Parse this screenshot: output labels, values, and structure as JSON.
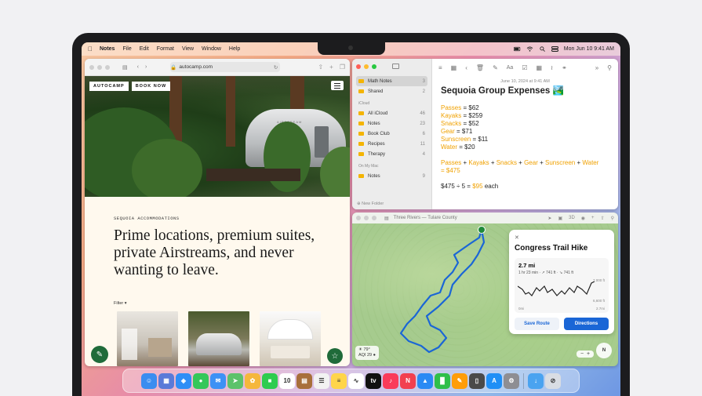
{
  "menubar": {
    "app": "Notes",
    "items": [
      "File",
      "Edit",
      "Format",
      "View",
      "Window",
      "Help"
    ],
    "clock": "Mon Jun 10  9:41 AM"
  },
  "safari": {
    "url": "autocamp.com",
    "brand_name": "AUTOCAMP",
    "brand_cta": "BOOK NOW",
    "eyebrow": "SEQUOIA ACCOMMODATIONS",
    "headline": "Prime locations, premium suites, private Airstreams, and never wanting to leave.",
    "filter": "Filter ▾",
    "airstream_text": "AIRSTREAM"
  },
  "notes": {
    "folders_top": [
      {
        "name": "Math Notes",
        "count": "3"
      },
      {
        "name": "Shared",
        "count": "2"
      }
    ],
    "section_icloud": "iCloud",
    "folders_icloud": [
      {
        "name": "All iCloud",
        "count": "46"
      },
      {
        "name": "Notes",
        "count": "23"
      },
      {
        "name": "Book Club",
        "count": "6"
      },
      {
        "name": "Recipes",
        "count": "11"
      },
      {
        "name": "Therapy",
        "count": "4"
      }
    ],
    "section_mac": "On My Mac",
    "folders_mac": [
      {
        "name": "Notes",
        "count": "9"
      }
    ],
    "new_folder": "New Folder",
    "date": "June 10, 2024 at 9:41 AM",
    "title": "Sequoia Group Expenses 🏞️",
    "lines": [
      {
        "label": "Passes",
        "value": "= $62"
      },
      {
        "label": "Kayaks",
        "value": "= $259"
      },
      {
        "label": "Snacks",
        "value": "= $52"
      },
      {
        "label": "Gear",
        "value": "= $71"
      },
      {
        "label": "Sunscreen",
        "value": "= $11"
      },
      {
        "label": "Water",
        "value": "= $20"
      }
    ],
    "sum_terms": [
      "Passes",
      "Kayaks",
      "Snacks",
      "Gear",
      "Sunscreen",
      "Water"
    ],
    "sum_result": "= $475",
    "split_expr": "$475 ÷ 5 =",
    "split_result": "$95",
    "split_suffix": "each"
  },
  "maps": {
    "location": "Three Rivers — Tulare County",
    "card_title": "Congress Trail Hike",
    "distance": "2.7 mi",
    "meta": "1 hr 23 min  ·  ↗ 741 ft  ·  ↘ 741 ft",
    "elev_max": "7,000 ft",
    "elev_min": "6,600 ft",
    "x_start": "0mi",
    "x_end": "2.7mi",
    "save_route": "Save Route",
    "directions": "Directions",
    "weather_temp": "☀ 79°",
    "weather_aqi": "AQI 29 ●",
    "compass": "N",
    "toolbar_3d": "3D"
  },
  "colors": {
    "accent_blue": "#1a66d6",
    "notes_yellow": "#f0a100",
    "autocamp_green": "#1f6b3a"
  },
  "dock_apps": [
    {
      "name": "finder-icon",
      "color": "#3b8df0",
      "glyph": "☺"
    },
    {
      "name": "launchpad-icon",
      "color": "#5a7ad8",
      "glyph": "▦"
    },
    {
      "name": "safari-icon",
      "color": "#2f8ef6",
      "glyph": "◈"
    },
    {
      "name": "messages-icon",
      "color": "#34c759",
      "glyph": "●"
    },
    {
      "name": "mail-icon",
      "color": "#3d91f5",
      "glyph": "✉"
    },
    {
      "name": "maps-icon",
      "color": "#5cc26a",
      "glyph": "➤"
    },
    {
      "name": "photos-icon",
      "color": "#f5b73b",
      "glyph": "✿"
    },
    {
      "name": "facetime-icon",
      "color": "#2ecc4f",
      "glyph": "■"
    },
    {
      "name": "calendar-icon",
      "color": "#ffffff",
      "glyph": "10"
    },
    {
      "name": "notes-yellow-icon",
      "color": "#a86f3a",
      "glyph": "▤"
    },
    {
      "name": "reminders-icon",
      "color": "#f2f2f2",
      "glyph": "☰"
    },
    {
      "name": "notes-icon",
      "color": "#ffd54a",
      "glyph": "≡"
    },
    {
      "name": "freeform-icon",
      "color": "#ffffff",
      "glyph": "∿"
    },
    {
      "name": "tv-icon",
      "color": "#111111",
      "glyph": "tv"
    },
    {
      "name": "music-icon",
      "color": "#fa3c5a",
      "glyph": "♪"
    },
    {
      "name": "news-icon",
      "color": "#f2404f",
      "glyph": "N"
    },
    {
      "name": "keynote-icon",
      "color": "#2a8af4",
      "glyph": "▲"
    },
    {
      "name": "numbers-icon",
      "color": "#2fbf4a",
      "glyph": "█"
    },
    {
      "name": "pages-icon",
      "color": "#ff9d0a",
      "glyph": "✎"
    },
    {
      "name": "iphone-mirroring-icon",
      "color": "#4a4a4a",
      "glyph": "▯"
    },
    {
      "name": "app-store-icon",
      "color": "#1f8ff6",
      "glyph": "A"
    },
    {
      "name": "system-settings-icon",
      "color": "#8e8e93",
      "glyph": "⚙"
    },
    {
      "name": "downloads-folder-icon",
      "color": "#4aa3f0",
      "glyph": "↓"
    },
    {
      "name": "trash-icon",
      "color": "#d9dde3",
      "glyph": "⊘"
    }
  ]
}
